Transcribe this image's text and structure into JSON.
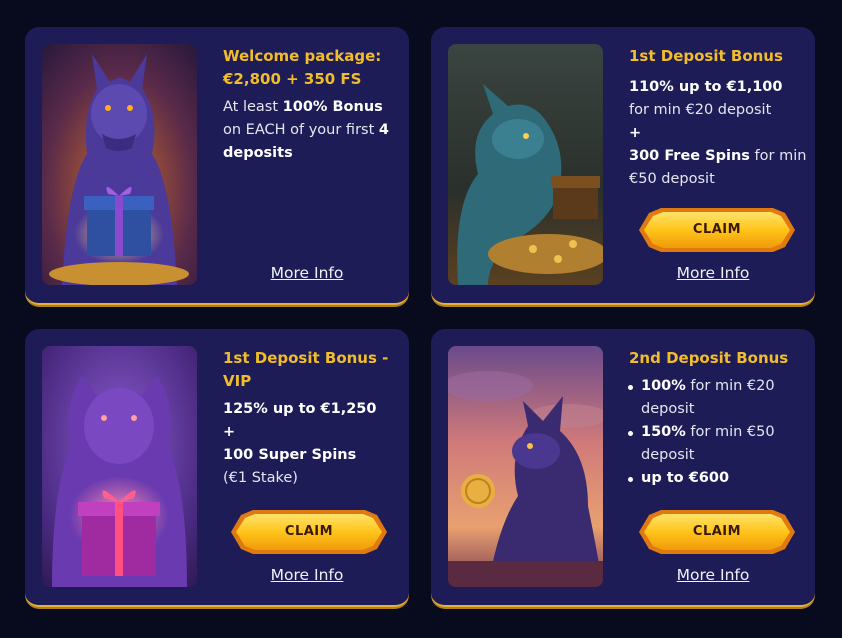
{
  "cards": [
    {
      "title": "Welcome package: €2,800 + 350 FS",
      "desc": {
        "p1": "At least ",
        "b1": "100% Bonus",
        "p2": " on EACH of your first ",
        "b2": "4 deposits"
      },
      "more_info": "More Info",
      "image_icon": "dragon-with-gift-icon"
    },
    {
      "title": "1st Deposit Bonus",
      "desc": {
        "b1": "110% up to €1,100",
        "p1": " for min €20 deposit",
        "plus": "+",
        "b2": "300 Free Spins",
        "p2": " for min €50 deposit"
      },
      "claim": "CLAIM",
      "more_info": "More Info",
      "image_icon": "dragon-with-treasure-icon"
    },
    {
      "title": "1st Deposit Bonus - VIP",
      "desc": {
        "b1": "125% up to €1,250",
        "plus": "+",
        "b2": "100 Super Spins",
        "p1": "(€1 Stake)"
      },
      "claim": "CLAIM",
      "more_info": "More Info",
      "image_icon": "purple-dragon-with-gift-icon"
    },
    {
      "title": "2nd Deposit Bonus",
      "bullets": [
        {
          "b": "100%",
          "t": " for min €20 deposit"
        },
        {
          "b": "150%",
          "t": " for min €50 deposit"
        },
        {
          "b": "up to €600",
          "t": ""
        }
      ],
      "claim": "CLAIM",
      "more_info": "More Info",
      "image_icon": "dragon-with-coin-icon"
    }
  ],
  "colors": {
    "background": "#070b1d",
    "card": "#1d1c57",
    "accent": "#f2bd2a",
    "border": "#e6b23a"
  }
}
